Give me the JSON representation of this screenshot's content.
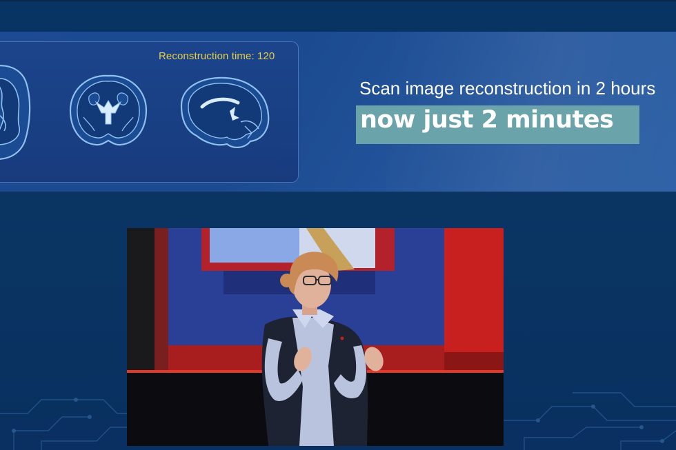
{
  "slide": {
    "reconstruction_label": "Reconstruction time: 120",
    "headline_line1": "Scan image reconstruction in 2 hours",
    "headline_line2": "now just 2 minutes"
  },
  "icons": [
    "brain-sagittal-icon",
    "brain-coronal-icon",
    "brain-side-icon"
  ],
  "colors": {
    "background": "#0a3463",
    "banner": "#1d4a92",
    "accent_yellow": "#e5cf4a",
    "highlight_teal": "#6aa4aa",
    "brain_fill": "#1b4b93",
    "brain_outline": "#8fc0ee"
  }
}
